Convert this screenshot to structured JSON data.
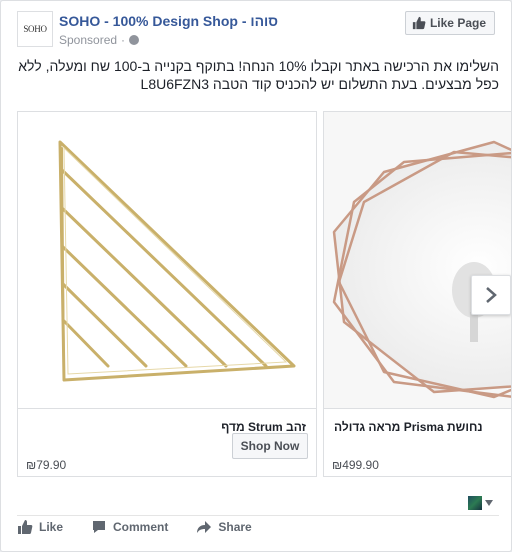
{
  "header": {
    "logo_text": "SOHO",
    "page_name": "SOHO - 100% Design Shop - סוהו",
    "sponsored": "Sponsored",
    "separator": "·",
    "like_page_label": "Like Page"
  },
  "post": {
    "text": "השלימו את הרכישה באתר וקבלו 10% הנחה! בתוקף בקנייה ב-100 שח ומעלה, ללא כפל מבצעים. בעת התשלום יש להכניס קוד הטבה L8U6FZN3"
  },
  "carousel": {
    "items": [
      {
        "title": "זהב Strum מדף",
        "price": "₪79.90",
        "cta": "Shop Now"
      },
      {
        "title": "נחושת Prisma מראה גדולה",
        "price": "₪499.90"
      }
    ]
  },
  "actions": {
    "like": "Like",
    "comment": "Comment",
    "share": "Share"
  },
  "colors": {
    "link": "#365899",
    "muted": "#90949c",
    "brass": "#c9b06a",
    "copper": "#c99a85"
  }
}
